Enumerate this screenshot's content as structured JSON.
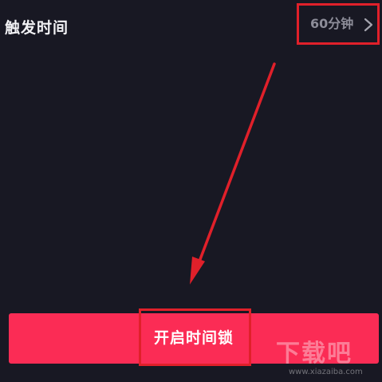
{
  "setting": {
    "label": "触发时间",
    "value": "60分钟"
  },
  "button": {
    "label": "开启时间锁"
  },
  "watermark": {
    "text": "下载吧",
    "url": "www.xiazaiba.com"
  },
  "colors": {
    "background": "#181823",
    "accent": "#fb2c55",
    "annotation": "#e0202a",
    "value_text": "#8d8d99"
  },
  "icons": {
    "row_chevron": "chevron-right-icon"
  }
}
